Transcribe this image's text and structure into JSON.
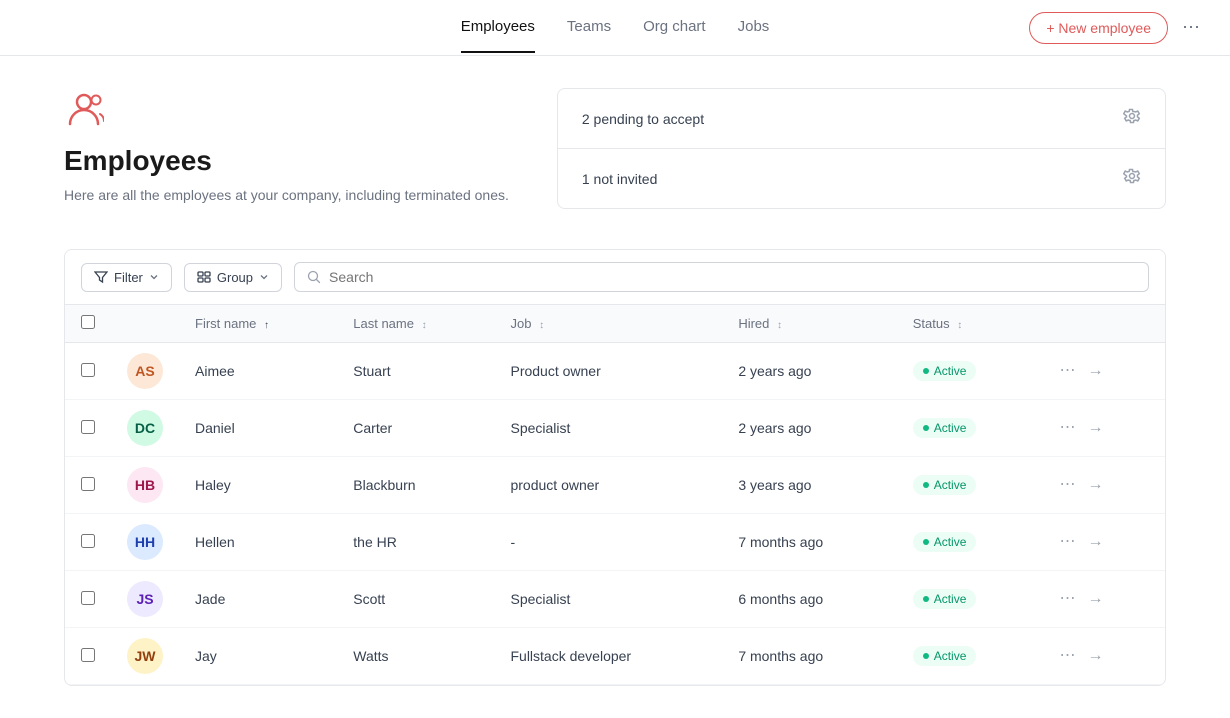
{
  "nav": {
    "links": [
      {
        "label": "Employees",
        "active": true
      },
      {
        "label": "Teams",
        "active": false
      },
      {
        "label": "Org chart",
        "active": false
      },
      {
        "label": "Jobs",
        "active": false
      }
    ],
    "new_employee_label": "+ New employee",
    "more_icon": "⋯"
  },
  "page": {
    "icon": "👥",
    "title": "Employees",
    "description": "Here are all the employees at your company, including terminated ones."
  },
  "stats": [
    {
      "text": "2 pending to accept"
    },
    {
      "text": "1 not invited"
    }
  ],
  "toolbar": {
    "filter_label": "Filter",
    "group_label": "Group",
    "search_placeholder": "Search"
  },
  "table": {
    "columns": [
      {
        "label": "First name",
        "sort": "asc",
        "key": "firstName"
      },
      {
        "label": "Last name",
        "sort": "default",
        "key": "lastName"
      },
      {
        "label": "Job",
        "sort": "default",
        "key": "job"
      },
      {
        "label": "Hired",
        "sort": "default",
        "key": "hired"
      },
      {
        "label": "Status",
        "sort": "default",
        "key": "status"
      }
    ],
    "rows": [
      {
        "firstName": "Aimee",
        "lastName": "Stuart",
        "job": "Product owner",
        "hired": "2 years ago",
        "status": "Active",
        "initials": "AS",
        "avClass": "av-1"
      },
      {
        "firstName": "Daniel",
        "lastName": "Carter",
        "job": "Specialist",
        "hired": "2 years ago",
        "status": "Active",
        "initials": "DC",
        "avClass": "av-2"
      },
      {
        "firstName": "Haley",
        "lastName": "Blackburn",
        "job": "product owner",
        "hired": "3 years ago",
        "status": "Active",
        "initials": "HB",
        "avClass": "av-3"
      },
      {
        "firstName": "Hellen",
        "lastName": "the HR",
        "job": "-",
        "hired": "7 months ago",
        "status": "Active",
        "initials": "HH",
        "avClass": "av-4"
      },
      {
        "firstName": "Jade",
        "lastName": "Scott",
        "job": "Specialist",
        "hired": "6 months ago",
        "status": "Active",
        "initials": "JS",
        "avClass": "av-5"
      },
      {
        "firstName": "Jay",
        "lastName": "Watts",
        "job": "Fullstack developer",
        "hired": "7 months ago",
        "status": "Active",
        "initials": "JW",
        "avClass": "av-6"
      }
    ]
  }
}
